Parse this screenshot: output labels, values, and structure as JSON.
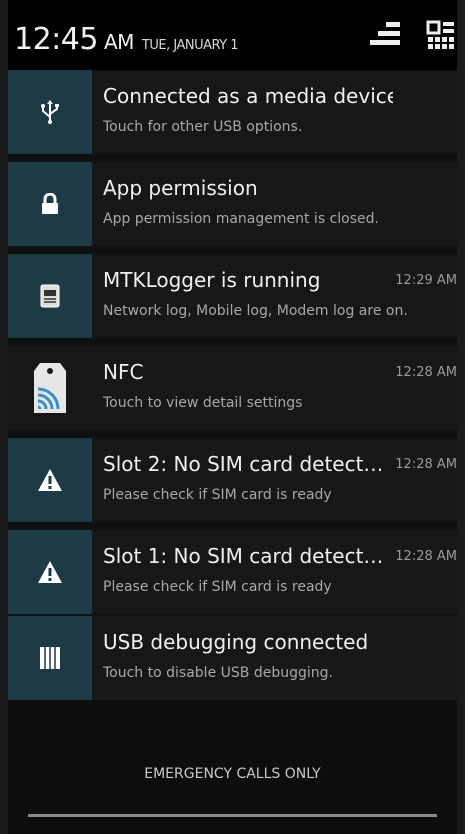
{
  "status": {
    "time": "12:45",
    "ampm": "AM",
    "date": "TUE, JANUARY 1"
  },
  "header_icons": [
    "settings-toggle-icon",
    "quick-settings-grid-icon"
  ],
  "notifications": [
    {
      "icon": "usb-icon",
      "title": "Connected as a media device",
      "subtitle": "Touch for other USB options.",
      "time": ""
    },
    {
      "icon": "lock-icon",
      "title": "App permission",
      "subtitle": "App permission management is closed.",
      "time": ""
    },
    {
      "icon": "log-file-icon",
      "title": "MTKLogger is running",
      "subtitle": "Network log, Mobile log, Modem log are on.",
      "time": "12:29 AM"
    },
    {
      "icon": "nfc-icon",
      "title": "NFC",
      "subtitle": "Touch to view detail settings",
      "time": "12:28 AM"
    },
    {
      "icon": "warning-icon",
      "title": "Slot 2: No SIM card detect…",
      "subtitle": "Please check if SIM card is ready",
      "time": "12:28 AM"
    },
    {
      "icon": "warning-icon",
      "title": "Slot 1: No SIM card detect…",
      "subtitle": "Please check if SIM card is ready",
      "time": "12:28 AM"
    },
    {
      "icon": "usb-debug-icon",
      "title": "USB debugging connected",
      "subtitle": "Touch to disable USB debugging.",
      "time": ""
    }
  ],
  "footer": {
    "emergency": "EMERGENCY CALLS ONLY"
  },
  "colors": {
    "icon_tile": "#1d3a46",
    "card_bg": "#171717"
  }
}
